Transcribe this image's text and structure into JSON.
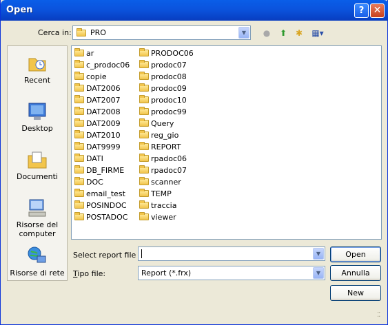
{
  "window": {
    "title": "Open",
    "help_glyph": "?",
    "close_glyph": "✕"
  },
  "lookin": {
    "label": "Cerca in:",
    "value": "PRO"
  },
  "toolbar": {
    "back_glyph": "●",
    "up_glyph": "⬆",
    "newfolder_glyph": "✱",
    "views_glyph": "▦▾"
  },
  "places": [
    {
      "label": "Recent",
      "icon": "recent-icon"
    },
    {
      "label": "Desktop",
      "icon": "desktop-icon"
    },
    {
      "label": "Documenti",
      "icon": "documents-icon"
    },
    {
      "label": "Risorse del computer",
      "icon": "computer-icon"
    },
    {
      "label": "Risorse di rete",
      "icon": "network-icon"
    }
  ],
  "folders_col1": [
    "ar",
    "c_prodoc06",
    "copie",
    "DAT2006",
    "DAT2007",
    "DAT2008",
    "DAT2009",
    "DAT2010",
    "DAT9999",
    "DATI",
    "DB_FIRME",
    "DOC",
    "email_test",
    "POSINDOC",
    "POSTADOC"
  ],
  "folders_col2": [
    "PRODOC06",
    "prodoc07",
    "prodoc08",
    "prodoc09",
    "prodoc10",
    "prodoc99",
    "Query",
    "reg_gio",
    "REPORT",
    "rpadoc06",
    "rpadoc07",
    "scanner",
    "TEMP",
    "traccia",
    "viewer"
  ],
  "filename": {
    "label": "Select report file",
    "value": ""
  },
  "filetype": {
    "label": "Tipo file:",
    "value": "Report (*.frx)"
  },
  "buttons": {
    "open": "Open",
    "cancel": "Annulla",
    "new": "New"
  }
}
